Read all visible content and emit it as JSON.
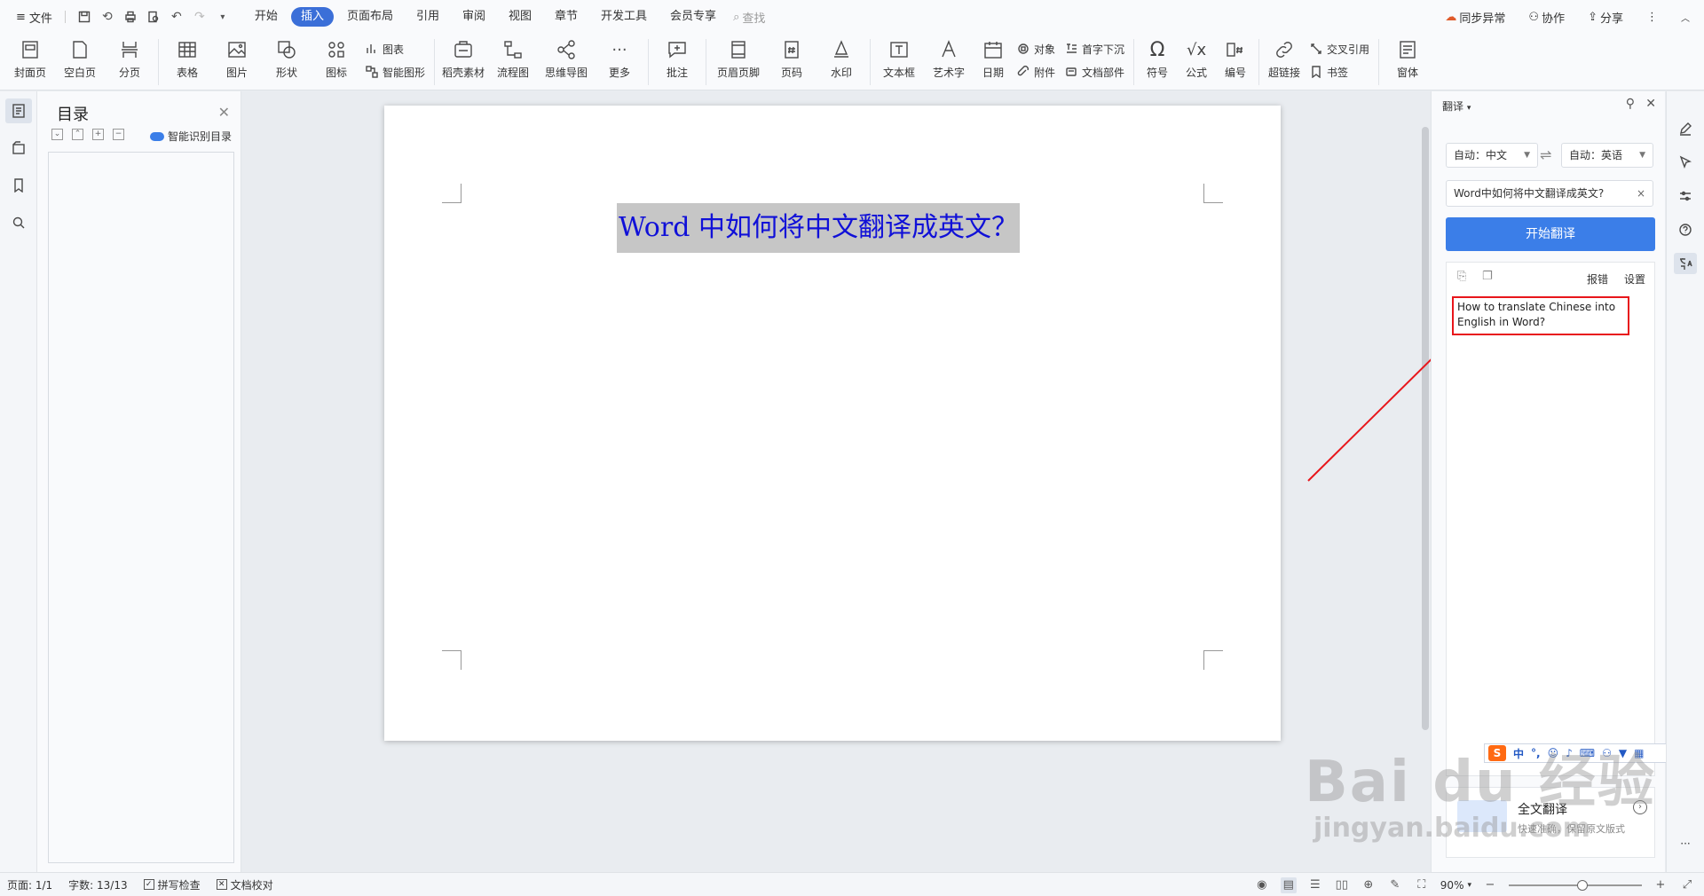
{
  "menubar": {
    "file_label": "文件",
    "tabs": [
      "开始",
      "插入",
      "页面布局",
      "引用",
      "审阅",
      "视图",
      "章节",
      "开发工具",
      "会员专享"
    ],
    "active_tab": "插入",
    "search_label": "查找",
    "sync_label": "同步异常",
    "collab_label": "协作",
    "share_label": "分享"
  },
  "ribbon": {
    "cover": "封面页",
    "blank": "空白页",
    "pagebreak": "分页",
    "table": "表格",
    "picture": "图片",
    "shape": "形状",
    "icon": "图标",
    "chart": "图表",
    "smartart": "智能图形",
    "material": "稻壳素材",
    "flowchart": "流程图",
    "mindmap": "思维导图",
    "more": "更多",
    "comment": "批注",
    "headerfooter": "页眉页脚",
    "pagenum": "页码",
    "watermark": "水印",
    "textbox": "文本框",
    "wordart": "艺术字",
    "date": "日期",
    "object": "对象",
    "attachment": "附件",
    "dropcap": "首字下沉",
    "docparts": "文档部件",
    "symbol": "符号",
    "formula": "公式",
    "numbering": "编号",
    "hyperlink": "超链接",
    "crossref": "交叉引用",
    "bookmark": "书签",
    "window": "窗体"
  },
  "toc": {
    "title": "目录",
    "smart_label": "智能识别目录"
  },
  "document": {
    "heading": "Word 中如何将中文翻译成英文？"
  },
  "translate": {
    "panel_title": "翻译",
    "source_lang": "自动：中文",
    "target_lang": "自动：英语",
    "input_text": "Word中如何将中文翻译成英文?",
    "start_button": "开始翻译",
    "report_label": "报错",
    "settings_label": "设置",
    "result_text": "How to translate Chinese into English in Word?",
    "full_translate_title": "全文翻译",
    "full_translate_sub": "快速准确，保留原文版式"
  },
  "ime": {
    "lang": "中"
  },
  "watermark": {
    "big": "Bai  du 经验",
    "small": "jingyan.baidu.com"
  },
  "statusbar": {
    "page": "页面: 1/1",
    "wordcount": "字数: 13/13",
    "spellcheck": "拼写检查",
    "proofread": "文档校对",
    "zoom": "90%",
    "zoom_fraction": 0.55
  },
  "colors": {
    "accent": "#3b7ee8",
    "arrow": "#e8161b",
    "heading_text": "#1010d8"
  }
}
